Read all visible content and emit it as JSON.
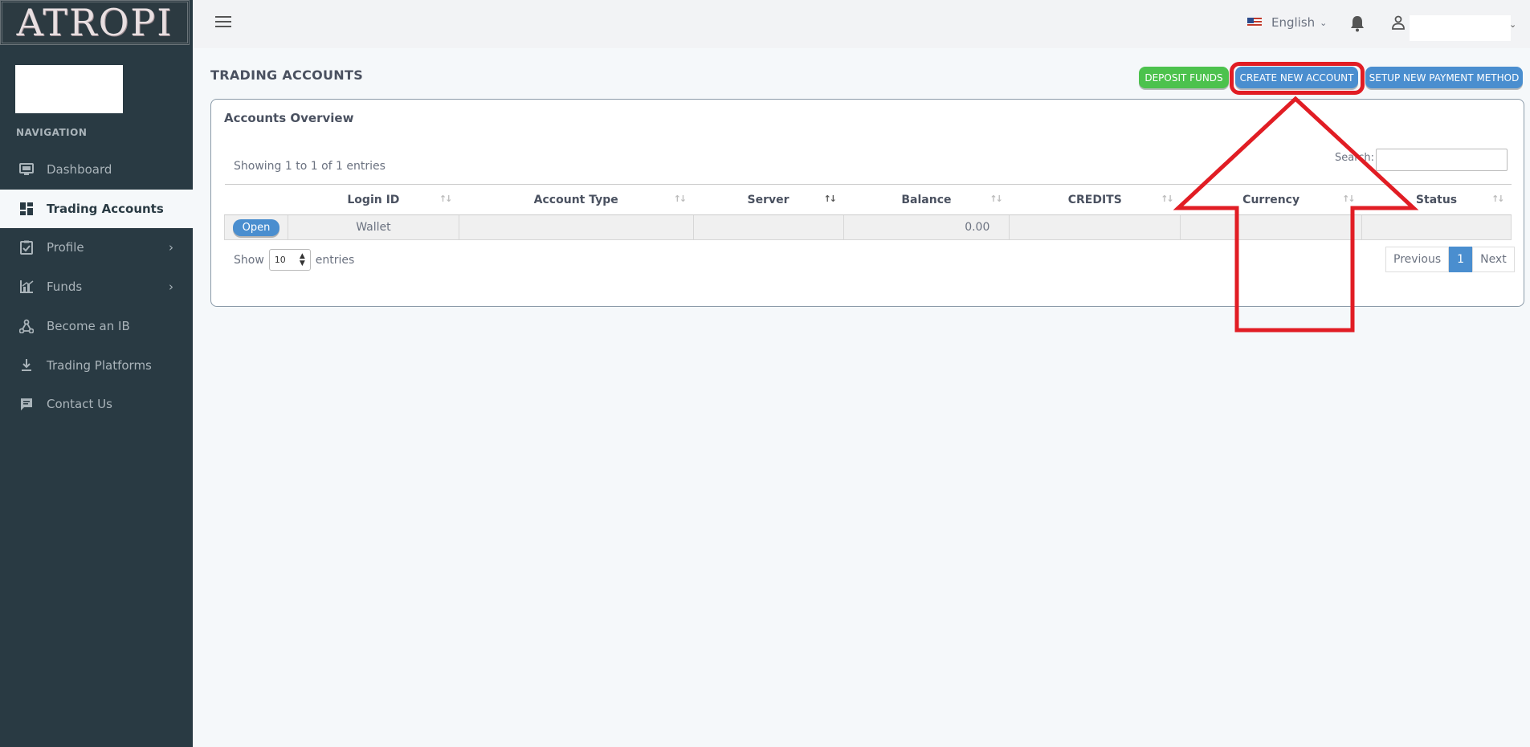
{
  "brand": {
    "logo_text": "ATROPI"
  },
  "sidebar": {
    "heading": "NAVIGATION",
    "items": [
      {
        "label": "Dashboard",
        "icon": "monitor-icon",
        "active": false
      },
      {
        "label": "Trading Accounts",
        "icon": "grid-icon",
        "active": true
      },
      {
        "label": "Profile",
        "icon": "clipboard-icon",
        "active": false,
        "expandable": true
      },
      {
        "label": "Funds",
        "icon": "chart-icon",
        "active": false,
        "expandable": true
      },
      {
        "label": "Become an IB",
        "icon": "network-icon",
        "active": false
      },
      {
        "label": "Trading Platforms",
        "icon": "download-icon",
        "active": false
      },
      {
        "label": "Contact Us",
        "icon": "chat-icon",
        "active": false
      }
    ]
  },
  "topbar": {
    "language": "English",
    "icons": [
      "menu-icon",
      "flag-icon",
      "bell-icon",
      "user-icon"
    ]
  },
  "page": {
    "title": "TRADING ACCOUNTS",
    "buttons": {
      "deposit": "DEPOSIT FUNDS",
      "create": "CREATE NEW ACCOUNT",
      "payment": "SETUP NEW PAYMENT METHOD"
    }
  },
  "card": {
    "title": "Accounts Overview",
    "showing": "Showing 1 to 1 of 1 entries",
    "search_label": "Search:",
    "columns": [
      "",
      "Login ID",
      "Account Type",
      "Server",
      "Balance",
      "CREDITS",
      "Currency",
      "Status"
    ],
    "rows": [
      {
        "action": "Open",
        "login_id": "Wallet",
        "account_type": "",
        "server": "",
        "balance": "0.00",
        "credits": "",
        "currency": "",
        "status": ""
      }
    ],
    "show_label": "Show",
    "entries_value": "10",
    "entries_label": "entries",
    "pager": {
      "previous": "Previous",
      "current": "1",
      "next": "Next"
    }
  },
  "colors": {
    "sidebar": "#293a43",
    "green": "#4cc24d",
    "blue": "#4a8ecf",
    "annotation": "#e11d24"
  }
}
